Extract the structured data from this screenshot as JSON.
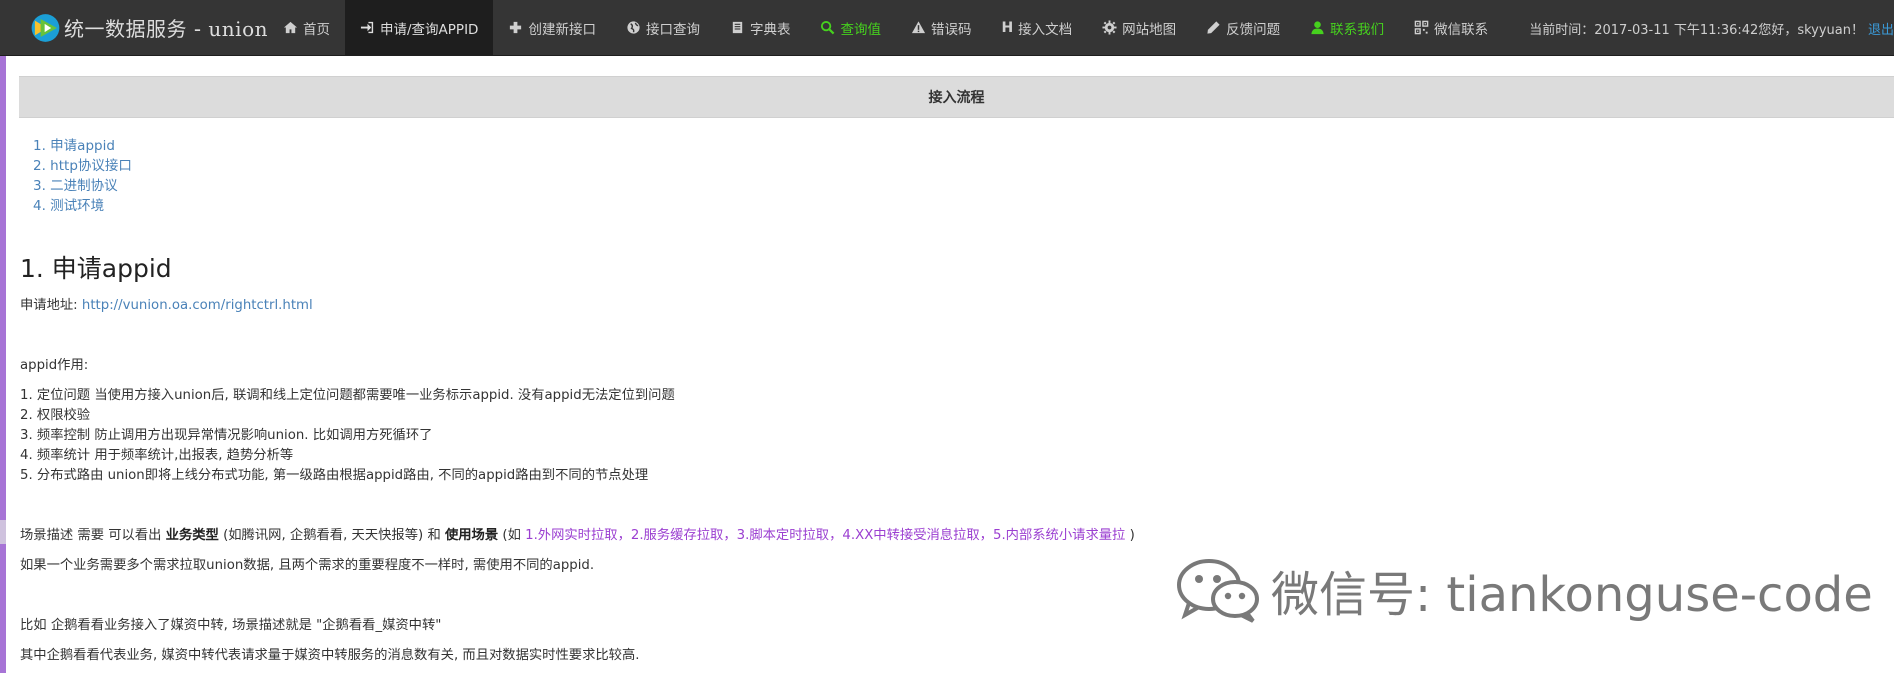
{
  "brand": {
    "title_cn": "统一数据服务",
    "title_sep": " - ",
    "title_en": "union"
  },
  "nav": [
    {
      "label": "首页",
      "icon": "home-icon"
    },
    {
      "label": "申请/查询APPID",
      "icon": "login-icon",
      "active": true
    },
    {
      "label": "创建新接口",
      "icon": "plus-icon"
    },
    {
      "label": "接口查询",
      "icon": "globe-icon"
    },
    {
      "label": "字典表",
      "icon": "book-icon"
    },
    {
      "label": "查询值",
      "icon": "search-icon",
      "color": "#46d11e"
    },
    {
      "label": "错误码",
      "icon": "warning-icon"
    },
    {
      "label": "接入文档",
      "icon": "h-icon",
      "icon_text": "H"
    },
    {
      "label": "网站地图",
      "icon": "gear-icon"
    },
    {
      "label": "反馈问题",
      "icon": "pencil-icon"
    },
    {
      "label": "联系我们",
      "icon": "user-icon",
      "color": "#46d11e"
    },
    {
      "label": "微信联系",
      "icon": "qrcode-icon"
    }
  ],
  "status": {
    "time_label": "当前时间：",
    "time": "2017-03-11 下午11:36:42",
    "greeting": " 您好，skyyuan！",
    "logout": "退出"
  },
  "flow_title": "接入流程",
  "toc": [
    "1. 申请appid",
    "2. http协议接口",
    "3. 二进制协议",
    "4. 测试环境"
  ],
  "section": {
    "heading": "1. 申请appid",
    "apply_label": "申请地址: ",
    "apply_url": "http://vunion.oa.com/rightctrl.html",
    "appid_role": "appid作用:",
    "roles": [
      "1. 定位问题 当使用方接入union后, 联调和线上定位问题都需要唯一业务标示appid. 没有appid无法定位到问题",
      "2. 权限校验",
      "3. 频率控制 防止调用方出现异常情况影响union. 比如调用方死循环了",
      "4. 频率统计 用于频率统计,出报表, 趋势分析等",
      "5. 分布式路由 union即将上线分布式功能, 第一级路由根据appid路由, 不同的appid路由到不同的节点处理"
    ],
    "scene": {
      "prefix": "场景描述 需要 可以看出 ",
      "bold1": "业务类型",
      "mid1": " (如腾讯网, 企鹅看看, 天天快报等) 和 ",
      "bold2": "使用场景",
      "mid2": " (如 ",
      "examples": "1.外网实时拉取，2.服务缓存拉取，3.脚本定时拉取，4.XX中转接受消息拉取，5.内部系统小请求量拉",
      "suffix": " )"
    },
    "multi": "如果一个业务需要多个需求拉取union数据, 且两个需求的重要程度不一样时, 需使用不同的appid.",
    "example1": "比如 企鹅看看业务接入了媒资中转, 场景描述就是 \"企鹅看看_媒资中转\"",
    "example2": "其中企鹅看看代表业务, 媒资中转代表请求量于媒资中转服务的消息数有关, 而且对数据实时性要求比较高."
  },
  "watermark": "微信号: tiankonguse-code"
}
